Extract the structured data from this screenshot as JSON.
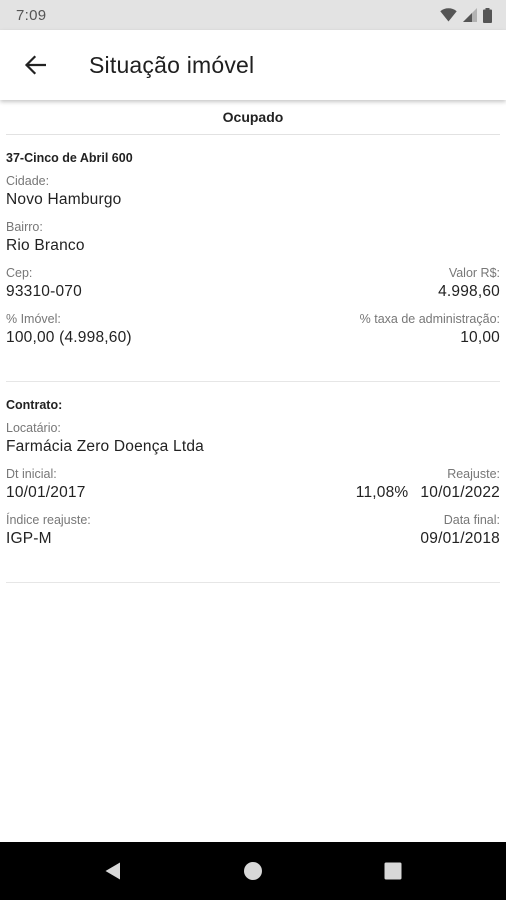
{
  "status_bar": {
    "time": "7:09"
  },
  "app_bar": {
    "title": "Situação imóvel"
  },
  "status_header": "Ocupado",
  "property": {
    "title": "37-Cinco de Abril 600",
    "cidade_label": "Cidade:",
    "cidade_value": "Novo Hamburgo",
    "bairro_label": "Bairro:",
    "bairro_value": "Rio Branco",
    "cep_label": "Cep:",
    "cep_value": "93310-070",
    "valor_label": "Valor R$:",
    "valor_value": "4.998,60",
    "pct_imovel_label": "% Imóvel:",
    "pct_imovel_value": "100,00 (4.998,60)",
    "taxa_adm_label": "% taxa de administração:",
    "taxa_adm_value": "10,00"
  },
  "contract": {
    "title": "Contrato:",
    "locatario_label": "Locatário:",
    "locatario_value": "Farmácia Zero Doença Ltda",
    "dt_inicial_label": "Dt inicial:",
    "dt_inicial_value": "10/01/2017",
    "reajuste_label": "Reajuste:",
    "reajuste_pct": "11,08%",
    "reajuste_date": "10/01/2022",
    "indice_label": "Índice reajuste:",
    "indice_value": "IGP-M",
    "data_final_label": "Data final:",
    "data_final_value": "09/01/2018"
  },
  "icons": {
    "back": "arrow-left-icon",
    "wifi": "wifi-icon",
    "signal": "cellular-signal-icon",
    "battery": "battery-icon",
    "nav_back": "triangle-back-icon",
    "nav_home": "circle-home-icon",
    "nav_recents": "square-recents-icon"
  }
}
